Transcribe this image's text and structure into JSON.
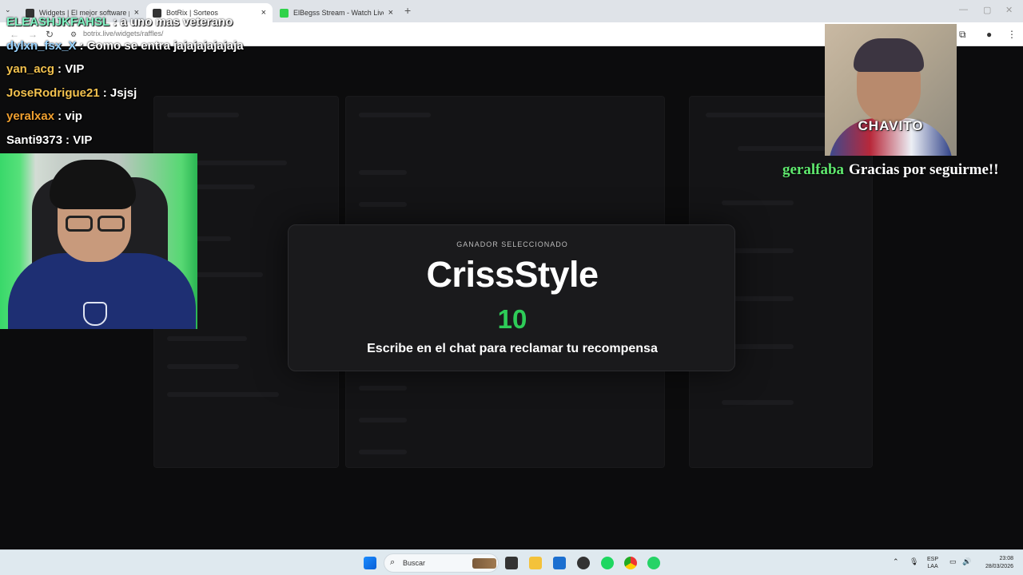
{
  "browser": {
    "tabs": [
      {
        "title": "Widgets | El mejor software para",
        "active": false
      },
      {
        "title": "BotRix | Sorteos",
        "active": true
      },
      {
        "title": "ElBegss Stream - Watch Live on",
        "active": false
      }
    ],
    "url": "botrix.live/widgets/raffles/"
  },
  "chat": [
    {
      "user": "dylxn_fsx_X",
      "message": "Como se entra jajajajajajaja",
      "color": "#9ad3ff"
    },
    {
      "user": "yan_acg",
      "message": "VIP",
      "color": "#f2c14e"
    },
    {
      "user": "JoseRodrigue21",
      "message": "Jsjsj",
      "color": "#f2c14e"
    },
    {
      "user": "yeralxax",
      "message": "vip",
      "color": "#f0a030"
    },
    {
      "user": "Santi9373",
      "message": "VIP",
      "color": "#ffffff"
    }
  ],
  "chat_partial_top": [
    {
      "user": "ELEASHJKFAHSL",
      "message": "a uno mas veterano",
      "color": "#7ff3c2"
    }
  ],
  "winner_modal": {
    "label": "GANADOR SELECCIONADO",
    "name": "CrissStyle",
    "number": "10",
    "message": "Escribe en el chat para reclamar tu recompensa",
    "accent": "#2ecc58"
  },
  "follow_alert": {
    "image_caption": "CHAVITO",
    "user": "geralfaba",
    "message": "Gracias por seguirme!!"
  },
  "taskbar": {
    "search_placeholder": "Buscar",
    "lang_top": "ESP",
    "lang_bottom": "LAA",
    "time": "23:08",
    "date": "28/03/2026"
  }
}
